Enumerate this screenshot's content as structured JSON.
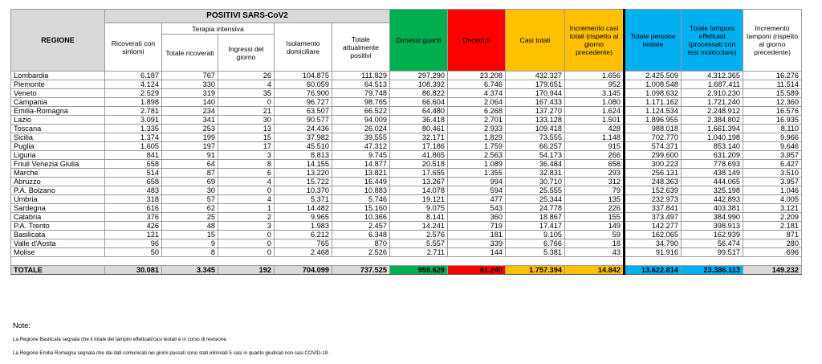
{
  "header": {
    "group_title": "POSITIVI SARS-CoV2",
    "region": "REGIONE",
    "ricoverati": "Ricoverati con sintomi",
    "terapia_intensiva": "Terapia intensiva",
    "totale_ricoverati": "Totale ricoverati",
    "ingressi_giorno": "Ingressi del giorno",
    "isolamento": "Isolamento domiciliare",
    "totale_positivi": "Totale attualmente positivi",
    "dimessi": "Dimessi guariti",
    "deceduti": "Deceduti",
    "casi_totali": "Casi totali",
    "incremento_casi": "Incremento casi totali (rispetto al giorno precedente)",
    "persone_testate": "Totale persone testate",
    "tamponi": "Totale tamponi effettuati (processati con test molecolare)",
    "incremento_tamponi": "Incremento tamponi (rispetto al giorno precedente)"
  },
  "colors": {
    "green": "#00b050",
    "red": "#ff0000",
    "orange": "#ffc000",
    "blue": "#00b0f0",
    "grey": "#d9d9d9"
  },
  "rows": [
    {
      "name": "Lombardia",
      "v": [
        "6.187",
        "767",
        "26",
        "104.875",
        "111.829",
        "297.290",
        "23.208",
        "432.327",
        "1.656",
        "2.425.509",
        "4.312.365",
        "16.276"
      ]
    },
    {
      "name": "Piemonte",
      "v": [
        "4.124",
        "330",
        "4",
        "60.059",
        "64.513",
        "108.392",
        "6.746",
        "179.651",
        "952",
        "1.008.548",
        "1.687.411",
        "11.514"
      ]
    },
    {
      "name": "Veneto",
      "v": [
        "2.529",
        "319",
        "35",
        "76.900",
        "79.748",
        "86.822",
        "4.374",
        "170.944",
        "3.145",
        "1.098.632",
        "2.910.230",
        "15.589"
      ]
    },
    {
      "name": "Campania",
      "v": [
        "1.898",
        "140",
        "0",
        "96.727",
        "98.765",
        "66.604",
        "2.064",
        "167.433",
        "1.080",
        "1.171.162",
        "1.721.240",
        "12.360"
      ]
    },
    {
      "name": "Emilia-Romagna",
      "v": [
        "2.781",
        "234",
        "21",
        "63.507",
        "66.522",
        "64.480",
        "6.268",
        "137.270",
        "1.624",
        "1.124.534",
        "2.248.912",
        "16.576"
      ]
    },
    {
      "name": "Lazio",
      "v": [
        "3.091",
        "341",
        "30",
        "90.577",
        "94.009",
        "36.418",
        "2.701",
        "133.128",
        "1.501",
        "1.896.955",
        "2.384.802",
        "16.935"
      ]
    },
    {
      "name": "Toscana",
      "v": [
        "1.335",
        "253",
        "13",
        "24.436",
        "26.024",
        "80.461",
        "2.933",
        "109.418",
        "428",
        "988.018",
        "1.661.394",
        "8.110"
      ]
    },
    {
      "name": "Sicilia",
      "v": [
        "1.374",
        "199",
        "15",
        "37.982",
        "39.555",
        "32.171",
        "1.829",
        "73.555",
        "1.148",
        "702.770",
        "1.040.198",
        "9.966"
      ]
    },
    {
      "name": "Puglia",
      "v": [
        "1.605",
        "197",
        "17",
        "45.510",
        "47.312",
        "17.186",
        "1.759",
        "66.257",
        "915",
        "574.371",
        "853.140",
        "9.646"
      ]
    },
    {
      "name": "Liguria",
      "v": [
        "841",
        "91",
        "3",
        "8.813",
        "9.745",
        "41.865",
        "2.563",
        "54.173",
        "266",
        "299.600",
        "631.209",
        "3.957"
      ]
    },
    {
      "name": "Friuli Venezia Giulia",
      "v": [
        "658",
        "64",
        "8",
        "14.155",
        "14.877",
        "20.518",
        "1.089",
        "36.484",
        "658",
        "300.223",
        "778.693",
        "6.427"
      ]
    },
    {
      "name": "Marche",
      "v": [
        "514",
        "87",
        "6",
        "13.220",
        "13.821",
        "17.655",
        "1.355",
        "32.831",
        "293",
        "256.131",
        "438.149",
        "3.510"
      ]
    },
    {
      "name": "Abruzzo",
      "v": [
        "658",
        "69",
        "4",
        "15.722",
        "16.449",
        "13.267",
        "994",
        "30.710",
        "312",
        "248.363",
        "444.065",
        "3.957"
      ]
    },
    {
      "name": "P.A. Bolzano",
      "v": [
        "483",
        "30",
        "0",
        "10.370",
        "10.883",
        "14.078",
        "594",
        "25.555",
        "79",
        "152.639",
        "325.198",
        "1.046"
      ]
    },
    {
      "name": "Umbria",
      "v": [
        "318",
        "57",
        "4",
        "5.371",
        "5.746",
        "19.121",
        "477",
        "25.344",
        "135",
        "232.973",
        "442.893",
        "4.005"
      ]
    },
    {
      "name": "Sardegna",
      "v": [
        "616",
        "62",
        "1",
        "14.482",
        "15.160",
        "9.075",
        "543",
        "24.778",
        "226",
        "337.841",
        "403.381",
        "3.121"
      ]
    },
    {
      "name": "Calabria",
      "v": [
        "376",
        "25",
        "2",
        "9.965",
        "10.366",
        "8.141",
        "360",
        "18.867",
        "155",
        "373.497",
        "384.990",
        "2.209"
      ]
    },
    {
      "name": "P.A. Trento",
      "v": [
        "426",
        "48",
        "3",
        "1.983",
        "2.457",
        "14.241",
        "719",
        "17.417",
        "149",
        "142.277",
        "398.913",
        "2.181"
      ]
    },
    {
      "name": "Basilicata",
      "v": [
        "121",
        "15",
        "0",
        "6.212",
        "6.348",
        "2.576",
        "181",
        "9.105",
        "59",
        "162.065",
        "162.939",
        "871"
      ]
    },
    {
      "name": "Valle d'Aosta",
      "v": [
        "96",
        "9",
        "0",
        "765",
        "870",
        "5.557",
        "339",
        "6.766",
        "18",
        "34.790",
        "56.474",
        "280"
      ]
    },
    {
      "name": "Molise",
      "v": [
        "50",
        "8",
        "0",
        "2.468",
        "2.526",
        "2.711",
        "144",
        "5.381",
        "43",
        "91.916",
        "99.517",
        "696"
      ]
    }
  ],
  "total": {
    "name": "TOTALE",
    "v": [
      "30.081",
      "3.345",
      "192",
      "704.099",
      "737.525",
      "958.629",
      "61.240",
      "1.757.394",
      "14.842",
      "13.622.814",
      "23.386.113",
      "149.232"
    ]
  },
  "notes": {
    "title": "Note:",
    "lines": [
      "La Regione Basilicata segnala che il totale dei tampini effettuati/casi testati è in corso di revisione.",
      "La Regione Emilia Romagna segnala che dai dati comunicati nei giorni passati sono stati eliminati 5 casi in quanto giudicati non casi COVID-19."
    ]
  }
}
